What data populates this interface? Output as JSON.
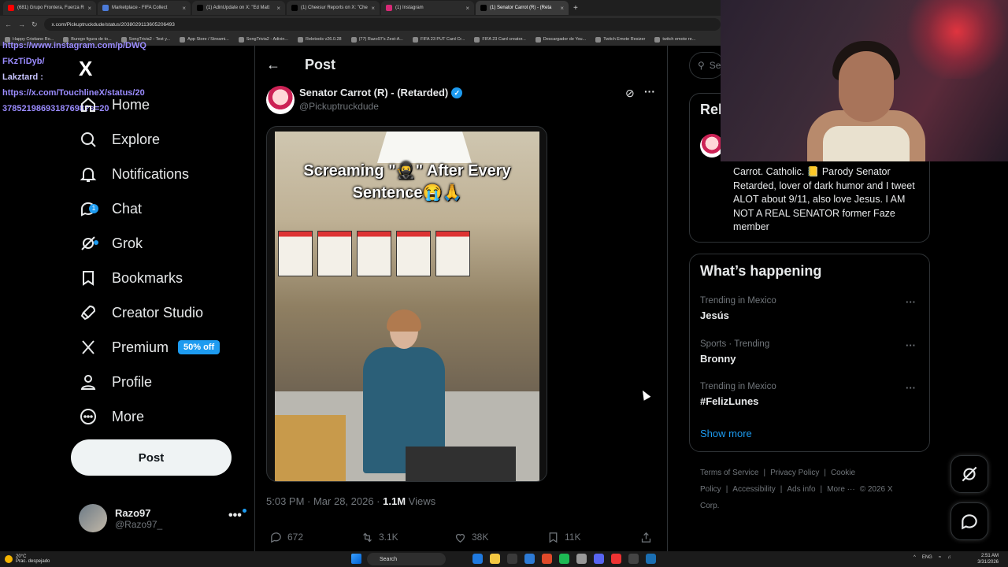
{
  "browser": {
    "tabs": [
      {
        "title": "(681) Grupo Frontera, Fuerza R",
        "color": "#ff0000",
        "active": false
      },
      {
        "title": "Marketplace - FIFA Collect",
        "color": "#4c7bd9",
        "active": false
      },
      {
        "title": "(1) AdinUpdate on X: \"Ed Matt",
        "color": "#000000",
        "active": false
      },
      {
        "title": "(1) Cheesur Reports on X: \"Che",
        "color": "#000000",
        "active": false
      },
      {
        "title": "(1) Instagram",
        "color": "#d62976",
        "active": false
      },
      {
        "title": "(1) Senator Carrot (R) - (Reta",
        "color": "#000000",
        "active": true
      }
    ],
    "url": "x.com/Pickuptruckdude/status/2038029113605206493",
    "bookmarks": [
      "Happy Cristiano Ro...",
      "Burego figura de to...",
      "SongTrivia2 - Test y...",
      "App Store / Streami...",
      "SongTrivia2 - Adivin...",
      "Reletools v26.0.28",
      "(77) Razo97's Zest-A...",
      "FIFA 23 PUT Card Cr...",
      "FIFA 23 Card creator...",
      "Descargador de You...",
      "Twitch Emote Resizer",
      "twitch emote re..."
    ]
  },
  "overlay_chat": {
    "line1": "https://www.instagram.com/p/DWQ",
    "line2": "FKzTiDyb/",
    "user": "Lakztard :",
    "line3": "https://x.com/TouchlineX/status/20",
    "line4": "37852198693187698?s=20"
  },
  "nav": {
    "logo": "X",
    "items": [
      {
        "label": "Home",
        "icon": "home-icon"
      },
      {
        "label": "Explore",
        "icon": "search-icon"
      },
      {
        "label": "Notifications",
        "icon": "bell-icon"
      },
      {
        "label": "Chat",
        "icon": "chat-icon",
        "badge": "1"
      },
      {
        "label": "Grok",
        "icon": "grok-icon"
      },
      {
        "label": "Bookmarks",
        "icon": "bookmark-icon"
      },
      {
        "label": "Creator Studio",
        "icon": "rocket-icon"
      },
      {
        "label": "Premium",
        "icon": "x-logo-icon",
        "pill": "50% off"
      },
      {
        "label": "Profile",
        "icon": "person-icon"
      },
      {
        "label": "More",
        "icon": "more-circle-icon"
      }
    ],
    "post_button": "Post",
    "account": {
      "name": "Razo97",
      "handle": "@Razo97_",
      "more": "•••"
    }
  },
  "main": {
    "title": "Post",
    "author": {
      "name": "Senator Carrot (R) - (Retarded)",
      "handle": "@Pickuptruckdude"
    },
    "video_caption": "Screaming \"🥷\" After Every Sentence😭🙏",
    "timestamp": "5:03 PM · Mar 28, 2026 ·",
    "views_count": "1.1M",
    "views_label": "Views",
    "actions": {
      "replies": "672",
      "reposts": "3.1K",
      "likes": "38K",
      "bookmarks": "11K"
    }
  },
  "right": {
    "search_placeholder": "Se",
    "relevant_title": "Rel",
    "bio": "Carrot. Catholic. 📒 Parody Senator Retarded, lover of dark humor and I tweet ALOT about 9/11, also love Jesus. I AM NOT A REAL SENATOR former Faze member",
    "happening_title": "What’s happening",
    "trends": [
      {
        "meta": "Trending in Mexico",
        "name": "Jesús"
      },
      {
        "meta": "Sports · Trending",
        "name": "Bronny"
      },
      {
        "meta": "Trending in Mexico",
        "name": "#FelizLunes"
      }
    ],
    "show_more": "Show more",
    "footer": [
      "Terms of Service",
      "|",
      "Privacy Policy",
      "|",
      "Cookie Policy",
      "|",
      "Accessibility",
      "|",
      "Ads info",
      "|",
      "More ···",
      "© 2026 X Corp."
    ]
  },
  "taskbar": {
    "weather_temp": "20°C",
    "weather_desc": "Prac. despejado",
    "search_label": "Search",
    "lang": "ENG",
    "time": "2:51 AM",
    "date": "3/31/2026"
  }
}
